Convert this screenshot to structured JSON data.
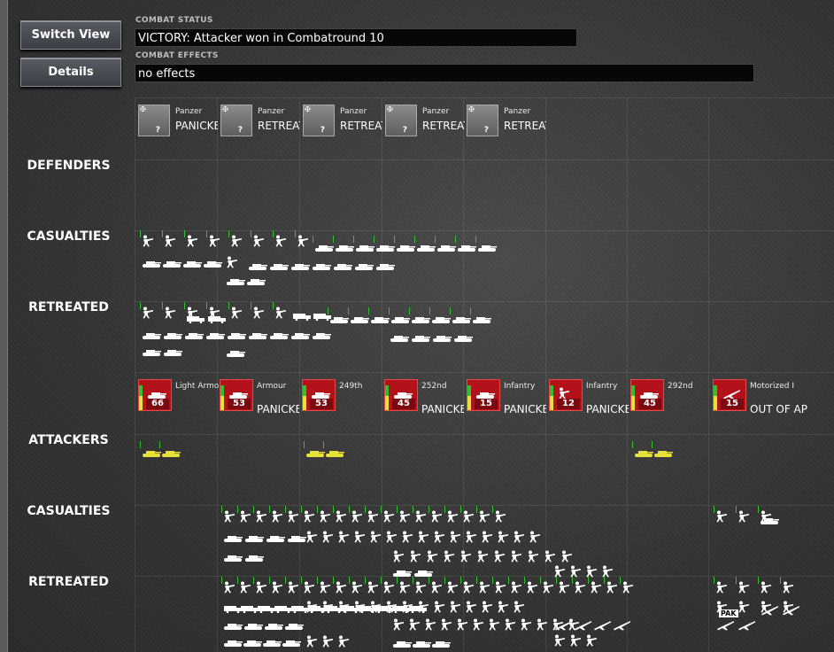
{
  "controls": {
    "switch_view": "Switch View",
    "details": "Details"
  },
  "combat_status": {
    "label": "COMBAT STATUS",
    "value": "VICTORY: Attacker won in Combatround  10"
  },
  "combat_effects": {
    "label": "COMBAT EFFECTS",
    "value": "no effects"
  },
  "rows": {
    "defenders": "DEFENDERS",
    "def_casualties": "CASUALTIES",
    "def_retreated": "RETREATED",
    "attackers": "ATTACKERS",
    "att_casualties": "CASUALTIES",
    "att_retreated": "RETREATED"
  },
  "defender_units": [
    {
      "name": "Panzer",
      "status": "PANICKE",
      "badge": "?"
    },
    {
      "name": "Panzer",
      "status": "RETREAT",
      "badge": "?"
    },
    {
      "name": "Panzer",
      "status": "RETREAT",
      "badge": "?"
    },
    {
      "name": "Panzer",
      "status": "RETREAT",
      "badge": "?"
    },
    {
      "name": "Panzer",
      "status": "RETREAT",
      "badge": "?"
    }
  ],
  "attacker_units": [
    {
      "name": "Light Armo",
      "status": "",
      "strength": "66",
      "icon": "tank-icon"
    },
    {
      "name": "Armour",
      "status": "PANICKE",
      "strength": "53",
      "icon": "tank-icon"
    },
    {
      "name": "249th",
      "status": "",
      "strength": "53",
      "icon": "tank-icon"
    },
    {
      "name": "252nd",
      "status": "PANICKE",
      "strength": "45",
      "icon": "tank-icon"
    },
    {
      "name": "Infantry",
      "status": "PANICKE",
      "strength": "15",
      "icon": "tank-icon"
    },
    {
      "name": "Infantry",
      "status": "PANICKE",
      "strength": "12",
      "icon": "soldier-icon"
    },
    {
      "name": "292nd",
      "status": "",
      "strength": "45",
      "icon": "tank-icon"
    },
    {
      "name": "Motorized In",
      "status": "OUT OF AP",
      "strength": "15",
      "icon": "gun-icon"
    }
  ],
  "misc": {
    "pak_label": "PAK"
  },
  "colors": {
    "accent_red": "#b4121a",
    "status_green": "#2fbf2f",
    "attack_yellow": "#e6e23a"
  }
}
